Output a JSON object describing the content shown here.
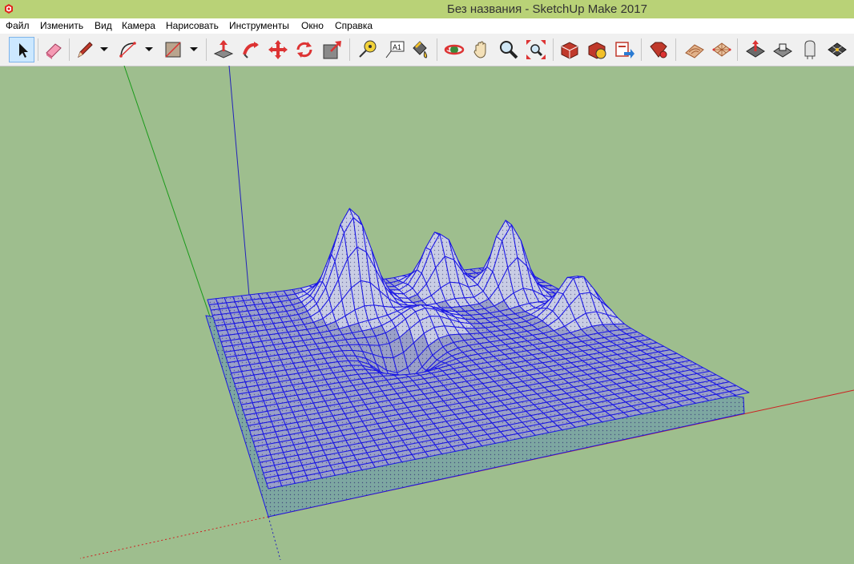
{
  "window": {
    "title": "Без названия - SketchUp Make 2017",
    "app_icon": "sketchup-logo-icon"
  },
  "menu": {
    "items": [
      "Файл",
      "Изменить",
      "Вид",
      "Камера",
      "Нарисовать",
      "Инструменты",
      "Окно",
      "Справка"
    ]
  },
  "toolbar": {
    "tools": [
      "select-arrow-icon",
      "eraser-icon",
      "pencil-line-icon",
      "arc-icon",
      "rectangle-icon",
      "push-pull-icon",
      "follow-me-icon",
      "move-icon",
      "rotate-icon",
      "scale-icon",
      "tape-measure-icon",
      "text-label-icon",
      "paint-bucket-icon",
      "orbit-icon",
      "pan-hand-icon",
      "zoom-icon",
      "zoom-extents-icon",
      "3d-warehouse-icon",
      "extension-warehouse-icon",
      "share-model-icon",
      "ruby-extension-icon",
      "sandbox-contours-icon",
      "sandbox-grid-icon",
      "smoove-icon",
      "stamp-icon",
      "drape-icon",
      "add-detail-icon"
    ],
    "selected_tool": "select-arrow-icon",
    "text_tool_glyph": "A1"
  },
  "colors": {
    "titlebar": "#b9d277",
    "viewport_background": "#9ebe8e",
    "mesh_selected": "#1a16e6",
    "axis_red": "#cc2222",
    "axis_green": "#1a9a1a",
    "axis_blue": "#2222bb"
  }
}
